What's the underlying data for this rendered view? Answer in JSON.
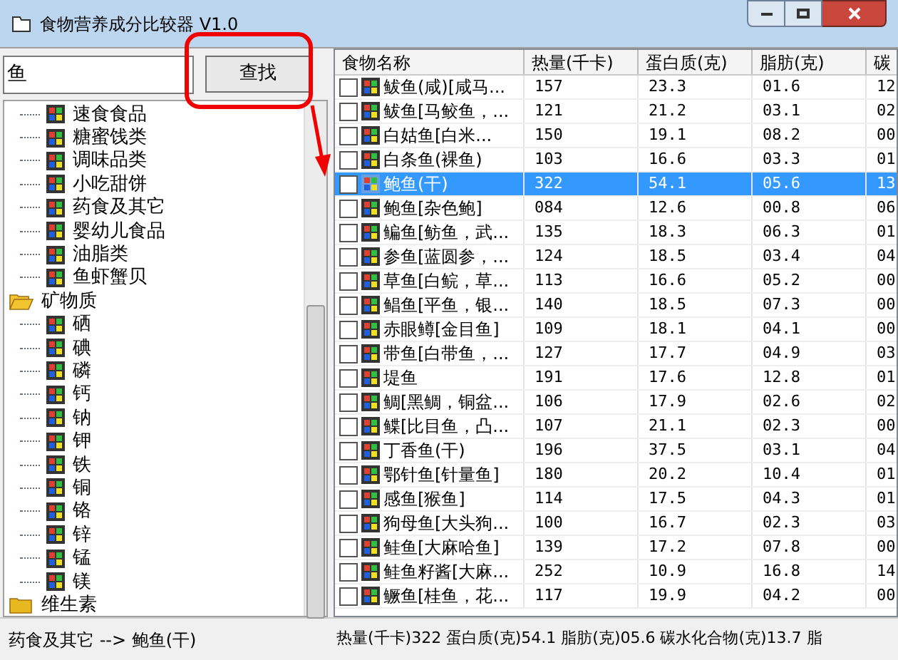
{
  "window": {
    "title": "食物营养成分比较器 V1.0"
  },
  "search": {
    "value": "鱼",
    "button": "查找"
  },
  "tree": [
    {
      "label": "速食食品",
      "kind": "leaf"
    },
    {
      "label": "糖蜜饯类",
      "kind": "leaf"
    },
    {
      "label": "调味品类",
      "kind": "leaf"
    },
    {
      "label": "小吃甜饼",
      "kind": "leaf"
    },
    {
      "label": "药食及其它",
      "kind": "leaf"
    },
    {
      "label": "婴幼儿食品",
      "kind": "leaf"
    },
    {
      "label": "油脂类",
      "kind": "leaf"
    },
    {
      "label": "鱼虾蟹贝",
      "kind": "leaf"
    },
    {
      "label": "矿物质",
      "kind": "folder",
      "expanded": true,
      "children": [
        {
          "label": "硒",
          "kind": "leaf"
        },
        {
          "label": "碘",
          "kind": "leaf"
        },
        {
          "label": "磷",
          "kind": "leaf"
        },
        {
          "label": "钙",
          "kind": "leaf"
        },
        {
          "label": "钠",
          "kind": "leaf"
        },
        {
          "label": "钾",
          "kind": "leaf"
        },
        {
          "label": "铁",
          "kind": "leaf"
        },
        {
          "label": "铜",
          "kind": "leaf"
        },
        {
          "label": "铬",
          "kind": "leaf"
        },
        {
          "label": "锌",
          "kind": "leaf"
        },
        {
          "label": "锰",
          "kind": "leaf"
        },
        {
          "label": "镁",
          "kind": "leaf"
        }
      ]
    },
    {
      "label": "维生素",
      "kind": "folder",
      "expanded": false
    }
  ],
  "table": {
    "columns": [
      "食物名称",
      "热量(千卡)",
      "蛋白质(克)",
      "脂肪(克)",
      "碳"
    ],
    "rows": [
      {
        "cells": [
          "鲅鱼(咸)[咸马...",
          "157",
          "23.3",
          "01.6",
          "12"
        ],
        "checked": false,
        "selected": false
      },
      {
        "cells": [
          "鲅鱼[马鲛鱼，...",
          "121",
          "21.2",
          "03.1",
          "02"
        ],
        "checked": false,
        "selected": false
      },
      {
        "cells": [
          "白姑鱼[白米...",
          "150",
          "19.1",
          "08.2",
          "00"
        ],
        "checked": false,
        "selected": false
      },
      {
        "cells": [
          "白条鱼(裸鱼)",
          "103",
          "16.6",
          "03.3",
          "01"
        ],
        "checked": false,
        "selected": false
      },
      {
        "cells": [
          "鲍鱼(干)",
          "322",
          "54.1",
          "05.6",
          "13"
        ],
        "checked": false,
        "selected": true
      },
      {
        "cells": [
          "鲍鱼[杂色鲍]",
          "084",
          "12.6",
          "00.8",
          "06"
        ],
        "checked": false,
        "selected": false
      },
      {
        "cells": [
          "鳊鱼[鲂鱼，武...",
          "135",
          "18.3",
          "06.3",
          "01"
        ],
        "checked": false,
        "selected": false
      },
      {
        "cells": [
          "参鱼[蓝圆参，...",
          "124",
          "18.5",
          "03.4",
          "04"
        ],
        "checked": false,
        "selected": false
      },
      {
        "cells": [
          "草鱼[白鲩，草...",
          "113",
          "16.6",
          "05.2",
          "00"
        ],
        "checked": false,
        "selected": false
      },
      {
        "cells": [
          "鲳鱼[平鱼，银...",
          "140",
          "18.5",
          "07.3",
          "00"
        ],
        "checked": false,
        "selected": false
      },
      {
        "cells": [
          "赤眼鳟[金目鱼]",
          "109",
          "18.1",
          "04.1",
          "00"
        ],
        "checked": false,
        "selected": false
      },
      {
        "cells": [
          "带鱼[白带鱼，...",
          "127",
          "17.7",
          "04.9",
          "03"
        ],
        "checked": false,
        "selected": false
      },
      {
        "cells": [
          "堤鱼",
          "191",
          "17.6",
          "12.8",
          "01"
        ],
        "checked": false,
        "selected": false
      },
      {
        "cells": [
          "鲷[黑鲷，铜盆...",
          "106",
          "17.9",
          "02.6",
          "02"
        ],
        "checked": false,
        "selected": false
      },
      {
        "cells": [
          "鲽[比目鱼，凸...",
          "107",
          "21.1",
          "02.3",
          "00"
        ],
        "checked": false,
        "selected": false
      },
      {
        "cells": [
          "丁香鱼(干)",
          "196",
          "37.5",
          "03.1",
          "04"
        ],
        "checked": false,
        "selected": false
      },
      {
        "cells": [
          "鄂针鱼[针量鱼]",
          "180",
          "20.2",
          "10.4",
          "01"
        ],
        "checked": false,
        "selected": false
      },
      {
        "cells": [
          "感鱼[猴鱼]",
          "114",
          "17.5",
          "04.3",
          "01"
        ],
        "checked": false,
        "selected": false
      },
      {
        "cells": [
          "狗母鱼[大头狗...",
          "100",
          "16.7",
          "02.3",
          "03"
        ],
        "checked": false,
        "selected": false
      },
      {
        "cells": [
          "鲑鱼[大麻哈鱼]",
          "139",
          "17.2",
          "07.8",
          "00"
        ],
        "checked": false,
        "selected": false
      },
      {
        "cells": [
          "鲑鱼籽酱[大麻...",
          "252",
          "10.9",
          "16.8",
          "14"
        ],
        "checked": false,
        "selected": false
      },
      {
        "cells": [
          "鳜鱼[桂鱼，花...",
          "117",
          "19.9",
          "04.2",
          "00"
        ],
        "checked": false,
        "selected": false
      }
    ]
  },
  "status_bar": {
    "left": "药食及其它 --> 鲍鱼(干)",
    "right": "热量(千卡)322 蛋白质(克)54.1 脂肪(克)05.6 碳水化合物(克)13.7 脂"
  }
}
